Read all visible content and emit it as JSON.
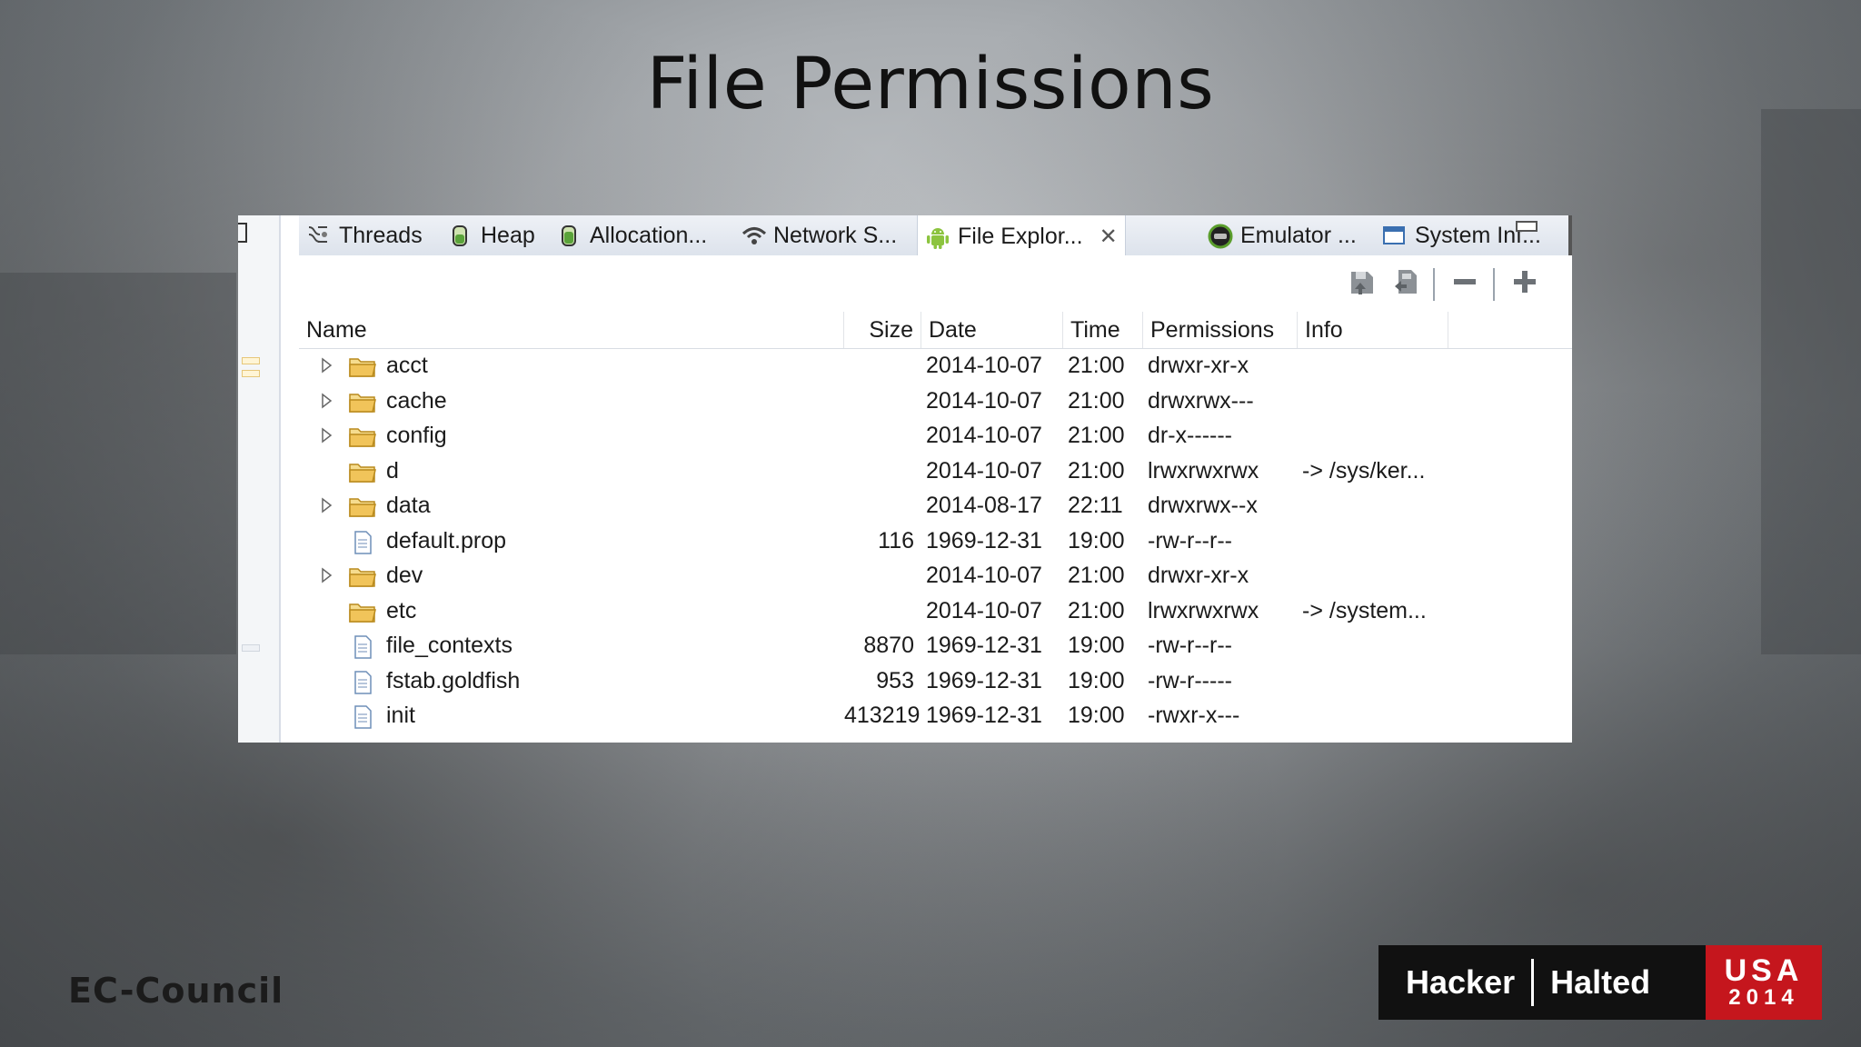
{
  "slide": {
    "title": "File Permissions"
  },
  "tabs": [
    {
      "label": "Threads",
      "icon": "threads-icon"
    },
    {
      "label": "Heap",
      "icon": "heap-icon"
    },
    {
      "label": "Allocation...",
      "icon": "allocation-icon"
    },
    {
      "label": "Network S...",
      "icon": "network-icon"
    },
    {
      "label": "File Explor...",
      "icon": "android-icon",
      "active": true
    },
    {
      "label": "Emulator ...",
      "icon": "emulator-icon"
    },
    {
      "label": "System Inf...",
      "icon": "window-icon"
    }
  ],
  "toolbar": {
    "pull_file": "pull-file-icon",
    "push_file": "push-file-icon",
    "delete": "minus-icon",
    "new_folder": "plus-icon"
  },
  "table": {
    "columns": [
      "Name",
      "Size",
      "Date",
      "Time",
      "Permissions",
      "Info"
    ],
    "rows": [
      {
        "name": "acct",
        "type": "folder",
        "expandable": true,
        "size": "",
        "date": "2014-10-07",
        "time": "21:00",
        "permissions": "drwxr-xr-x",
        "info": ""
      },
      {
        "name": "cache",
        "type": "folder",
        "expandable": true,
        "size": "",
        "date": "2014-10-07",
        "time": "21:00",
        "permissions": "drwxrwx---",
        "info": ""
      },
      {
        "name": "config",
        "type": "folder",
        "expandable": true,
        "size": "",
        "date": "2014-10-07",
        "time": "21:00",
        "permissions": "dr-x------",
        "info": ""
      },
      {
        "name": "d",
        "type": "folder",
        "expandable": false,
        "size": "",
        "date": "2014-10-07",
        "time": "21:00",
        "permissions": "lrwxrwxrwx",
        "info": "-> /sys/ker..."
      },
      {
        "name": "data",
        "type": "folder",
        "expandable": true,
        "size": "",
        "date": "2014-08-17",
        "time": "22:11",
        "permissions": "drwxrwx--x",
        "info": ""
      },
      {
        "name": "default.prop",
        "type": "file",
        "expandable": false,
        "size": "116",
        "date": "1969-12-31",
        "time": "19:00",
        "permissions": "-rw-r--r--",
        "info": ""
      },
      {
        "name": "dev",
        "type": "folder",
        "expandable": true,
        "size": "",
        "date": "2014-10-07",
        "time": "21:00",
        "permissions": "drwxr-xr-x",
        "info": ""
      },
      {
        "name": "etc",
        "type": "folder",
        "expandable": false,
        "size": "",
        "date": "2014-10-07",
        "time": "21:00",
        "permissions": "lrwxrwxrwx",
        "info": "-> /system..."
      },
      {
        "name": "file_contexts",
        "type": "file",
        "expandable": false,
        "size": "8870",
        "date": "1969-12-31",
        "time": "19:00",
        "permissions": "-rw-r--r--",
        "info": ""
      },
      {
        "name": "fstab.goldfish",
        "type": "file",
        "expandable": false,
        "size": "953",
        "date": "1969-12-31",
        "time": "19:00",
        "permissions": "-rw-r-----",
        "info": ""
      },
      {
        "name": "init",
        "type": "file",
        "expandable": false,
        "size": "413219",
        "date": "1969-12-31",
        "time": "19:00",
        "permissions": "-rwxr-x---",
        "info": ""
      }
    ]
  },
  "branding": {
    "left": "EC-Council",
    "logo_word1": "Hacker",
    "logo_word2": "Halted",
    "logo_country": "USA",
    "logo_year": "2014"
  },
  "colors": {
    "logo_red": "#c5161d",
    "folder_yellow": "#e9b94a",
    "android_green": "#8cc43f"
  }
}
